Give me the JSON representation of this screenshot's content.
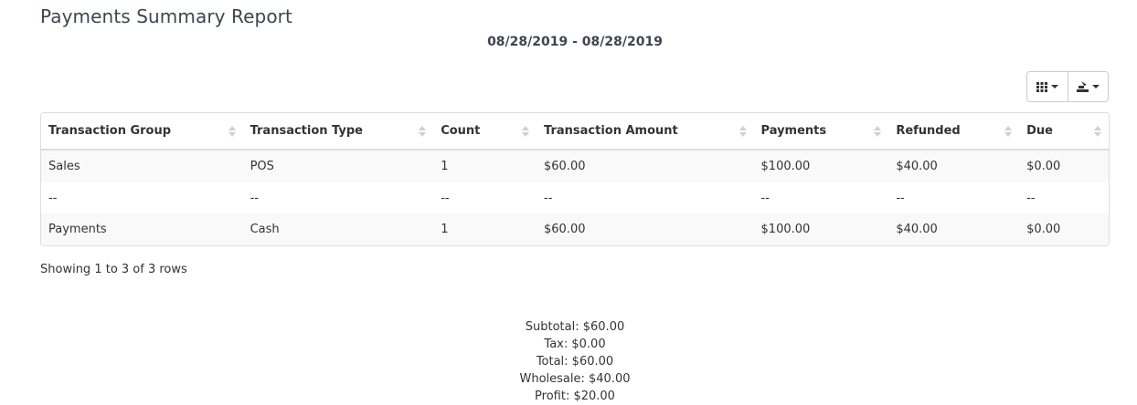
{
  "page": {
    "title": "Payments Summary Report",
    "date_range": "08/28/2019 - 08/28/2019"
  },
  "toolbar": {
    "columns_icon": "grid-icon",
    "export_icon": "export-icon"
  },
  "table": {
    "columns": [
      "Transaction Group",
      "Transaction Type",
      "Count",
      "Transaction Amount",
      "Payments",
      "Refunded",
      "Due"
    ],
    "rows": [
      [
        "Sales",
        "POS",
        "1",
        "$60.00",
        "$100.00",
        "$40.00",
        "$0.00"
      ],
      [
        "--",
        "--",
        "--",
        "--",
        "--",
        "--",
        "--"
      ],
      [
        "Payments",
        "Cash",
        "1",
        "$60.00",
        "$100.00",
        "$40.00",
        "$0.00"
      ]
    ]
  },
  "pagination": {
    "info": "Showing 1 to 3 of 3 rows"
  },
  "totals": {
    "subtotal": "Subtotal: $60.00",
    "tax": "Tax: $0.00",
    "total": "Total: $60.00",
    "wholesale": "Wholesale: $40.00",
    "profit": "Profit: $20.00"
  }
}
